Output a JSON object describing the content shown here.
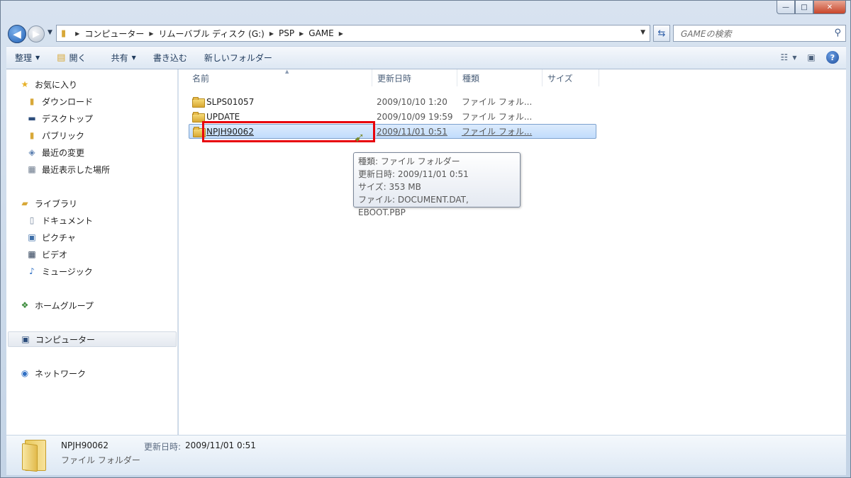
{
  "window": {
    "caption": {
      "minimize": "—",
      "maximize": "□",
      "close": "✕"
    }
  },
  "address": {
    "crumbs": [
      "コンピューター",
      "リムーバブル ディスク (G:)",
      "PSP",
      "GAME"
    ],
    "search_placeholder": "GAMEの検索"
  },
  "toolbar": {
    "organize": "整理",
    "open": "開く",
    "share": "共有",
    "burn": "書き込む",
    "new_folder": "新しいフォルダー"
  },
  "sidebar": {
    "favorites": "お気に入り",
    "downloads": "ダウンロード",
    "desktop": "デスクトップ",
    "public": "パブリック",
    "recent_changes": "最近の変更",
    "recent_places": "最近表示した場所",
    "libraries": "ライブラリ",
    "documents": "ドキュメント",
    "pictures": "ピクチャ",
    "videos": "ビデオ",
    "music": "ミュージック",
    "homegroup": "ホームグループ",
    "computer": "コンピューター",
    "network": "ネットワーク"
  },
  "columns": {
    "name": "名前",
    "modified": "更新日時",
    "type": "種類",
    "size": "サイズ"
  },
  "files": [
    {
      "name": "SLPS01057",
      "modified": "2009/10/10 1:20",
      "type": "ファイル フォル..."
    },
    {
      "name": "UPDATE",
      "modified": "2009/10/09 19:59",
      "type": "ファイル フォル..."
    },
    {
      "name": "NPJH90062",
      "modified": "2009/11/01 0:51",
      "type": "ファイル フォル..."
    }
  ],
  "tooltip": {
    "line1": "種類: ファイル フォルダー",
    "line2": "更新日時: 2009/11/01 0:51",
    "line3": "サイズ: 353 MB",
    "line4": "ファイル: DOCUMENT.DAT, EBOOT.PBP"
  },
  "details": {
    "name": "NPJH90062",
    "type": "ファイル フォルダー",
    "modified_label": "更新日時:",
    "modified_value": "2009/11/01 0:51"
  },
  "colors": {
    "highlight_box": "#e8000b",
    "selection": "#c1dcfc"
  }
}
